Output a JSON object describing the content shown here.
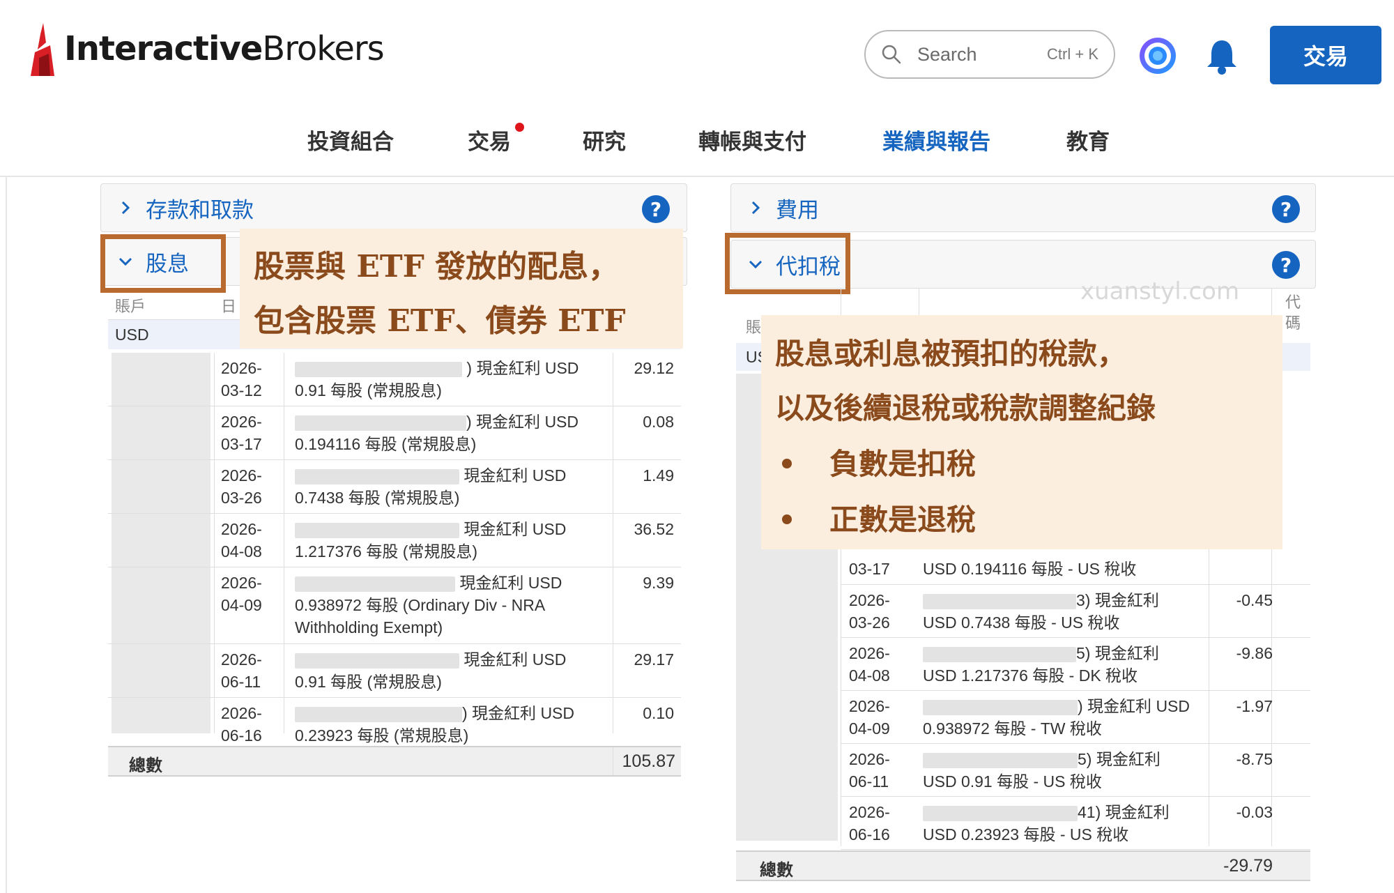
{
  "brand": {
    "logo_bold": "Interactive",
    "logo_regular": "Brokers"
  },
  "search": {
    "placeholder": "Search",
    "shortcut": "Ctrl + K"
  },
  "header": {
    "trade_button": "交易"
  },
  "nav": [
    {
      "label": "投資組合"
    },
    {
      "label": "交易",
      "has_dot": true
    },
    {
      "label": "研究"
    },
    {
      "label": "轉帳與支付"
    },
    {
      "label": "業績與報告",
      "active": true
    },
    {
      "label": "教育"
    }
  ],
  "left": {
    "collapsed_section": "存款和取款",
    "section": "股息",
    "col_account": "賬戶",
    "col_date": "日",
    "currency": "USD",
    "rows": [
      {
        "date1": "2026-",
        "date2": "03-12",
        "desc_tail": ") 現金紅利 USD",
        "desc2": "0.91 每股 (常規股息)",
        "amount": "29.12"
      },
      {
        "date1": "2026-",
        "date2": "03-17",
        "desc_tail": ") 現金紅利 USD",
        "desc2": "0.194116 每股 (常規股息)",
        "amount": "0.08"
      },
      {
        "date1": "2026-",
        "date2": "03-26",
        "desc_tail": "現金紅利 USD",
        "desc2": "0.7438 每股 (常規股息)",
        "amount": "1.49"
      },
      {
        "date1": "2026-",
        "date2": "04-08",
        "desc_tail": "現金紅利 USD",
        "desc2": "1.217376 每股 (常規股息)",
        "amount": "36.52"
      },
      {
        "date1": "2026-",
        "date2": "04-09",
        "desc_tail": "現金紅利 USD",
        "desc2": "0.938972 每股 (Ordinary Div - NRA",
        "desc3": "Withholding Exempt)",
        "amount": "9.39"
      },
      {
        "date1": "2026-",
        "date2": "06-11",
        "desc_tail": "現金紅利 USD",
        "desc2": "0.91 每股 (常規股息)",
        "amount": "29.17"
      },
      {
        "date1": "2026-",
        "date2": "06-16",
        "desc_tail": ") 現金紅利 USD",
        "desc2": "0.23923 每股 (常規股息)",
        "amount": "0.10"
      }
    ],
    "total_label": "總數",
    "total": "105.87"
  },
  "right": {
    "collapsed_section": "費用",
    "section": "代扣稅",
    "col_account": "賬",
    "col_code": "代碼",
    "currency": "US",
    "rows": [
      {
        "date2": "03-17",
        "desc2": "USD 0.194116 每股 - US 稅收",
        "amount": ""
      },
      {
        "date1": "2026-",
        "date2": "03-26",
        "desc_tail": "3) 現金紅利",
        "desc2": "USD 0.7438 每股 - US 稅收",
        "amount": "-0.45"
      },
      {
        "date1": "2026-",
        "date2": "04-08",
        "desc_tail": "5) 現金紅利",
        "desc2": "USD 1.217376 每股 - DK 稅收",
        "amount": "-9.86"
      },
      {
        "date1": "2026-",
        "date2": "04-09",
        "desc_tail": ") 現金紅利 USD",
        "desc2": "0.938972 每股 - TW 稅收",
        "amount": "-1.97"
      },
      {
        "date1": "2026-",
        "date2": "06-11",
        "desc_tail": "5) 現金紅利",
        "desc2": "USD 0.91 每股 - US 稅收",
        "amount": "-8.75"
      },
      {
        "date1": "2026-",
        "date2": "06-16",
        "desc_tail": "41) 現金紅利",
        "desc2": "USD 0.23923 每股 - US 稅收",
        "amount": "-0.03"
      }
    ],
    "total_label": "總數",
    "total": "-29.79"
  },
  "callout_left": {
    "line1": "股票與 ETF 發放的配息，",
    "line2": "包含股票 ETF、債券 ETF"
  },
  "callout_right": {
    "line1": "股息或利息被預扣的稅款，",
    "line2": "以及後續退稅或稅款調整紀錄",
    "bullet1": "負數是扣稅",
    "bullet2": "正數是退稅"
  },
  "watermark": "xuanstyl.com",
  "colors": {
    "accent": "#1565c0",
    "annotation_border": "#b86a2f",
    "callout_bg": "#fbeedf",
    "callout_text": "#8a4a1c",
    "nav_dot": "#e0151b"
  }
}
